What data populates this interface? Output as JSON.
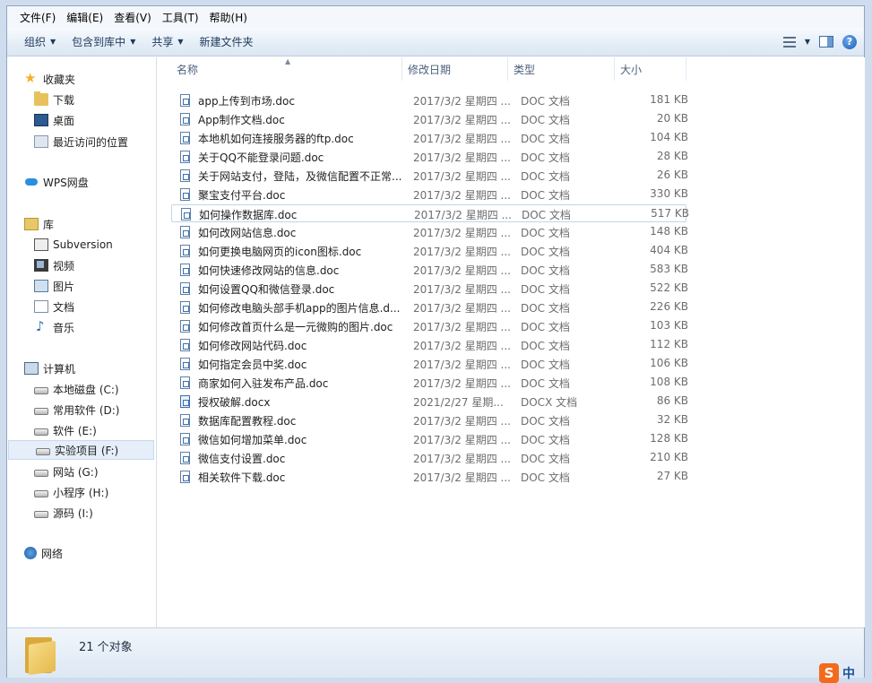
{
  "menu": [
    "文件(F)",
    "编辑(E)",
    "查看(V)",
    "工具(T)",
    "帮助(H)"
  ],
  "toolbar": {
    "organize": "组织",
    "include_in_library": "包含到库中",
    "share": "共享",
    "new_folder": "新建文件夹"
  },
  "nav": {
    "favorites": "收藏夹",
    "downloads": "下载",
    "desktop": "桌面",
    "recent": "最近访问的位置",
    "wps": "WPS网盘",
    "library": "库",
    "subversion": "Subversion",
    "videos": "视频",
    "pictures": "图片",
    "documents": "文档",
    "music": "音乐",
    "computer": "计算机",
    "drive_c": "本地磁盘 (C:)",
    "drive_d": "常用软件 (D:)",
    "drive_e": "软件 (E:)",
    "drive_f": "实验项目 (F:)",
    "drive_g": "网站 (G:)",
    "drive_h": "小程序 (H:)",
    "drive_i": "源码 (I:)",
    "network": "网络"
  },
  "columns": {
    "name": "名称",
    "date": "修改日期",
    "type": "类型",
    "size": "大小"
  },
  "files": [
    {
      "name": "app上传到市场.doc",
      "date": "2017/3/2 星期四 ...",
      "type": "DOC 文档",
      "size": "181 KB"
    },
    {
      "name": "App制作文档.doc",
      "date": "2017/3/2 星期四 ...",
      "type": "DOC 文档",
      "size": "20 KB"
    },
    {
      "name": "本地机如何连接服务器的ftp.doc",
      "date": "2017/3/2 星期四 ...",
      "type": "DOC 文档",
      "size": "104 KB"
    },
    {
      "name": "关于QQ不能登录问题.doc",
      "date": "2017/3/2 星期四 ...",
      "type": "DOC 文档",
      "size": "28 KB"
    },
    {
      "name": "关于网站支付，登陆，及微信配置不正常...",
      "date": "2017/3/2 星期四 ...",
      "type": "DOC 文档",
      "size": "26 KB"
    },
    {
      "name": "聚宝支付平台.doc",
      "date": "2017/3/2 星期四 ...",
      "type": "DOC 文档",
      "size": "330 KB"
    },
    {
      "name": "如何操作数据库.doc",
      "date": "2017/3/2 星期四 ...",
      "type": "DOC 文档",
      "size": "517 KB"
    },
    {
      "name": "如何改网站信息.doc",
      "date": "2017/3/2 星期四 ...",
      "type": "DOC 文档",
      "size": "148 KB"
    },
    {
      "name": "如何更换电脑网页的icon图标.doc",
      "date": "2017/3/2 星期四 ...",
      "type": "DOC 文档",
      "size": "404 KB"
    },
    {
      "name": "如何快速修改网站的信息.doc",
      "date": "2017/3/2 星期四 ...",
      "type": "DOC 文档",
      "size": "583 KB"
    },
    {
      "name": "如何设置QQ和微信登录.doc",
      "date": "2017/3/2 星期四 ...",
      "type": "DOC 文档",
      "size": "522 KB"
    },
    {
      "name": "如何修改电脑头部手机app的图片信息.d...",
      "date": "2017/3/2 星期四 ...",
      "type": "DOC 文档",
      "size": "226 KB"
    },
    {
      "name": "如何修改首页什么是一元微购的图片.doc",
      "date": "2017/3/2 星期四 ...",
      "type": "DOC 文档",
      "size": "103 KB"
    },
    {
      "name": "如何修改网站代码.doc",
      "date": "2017/3/2 星期四 ...",
      "type": "DOC 文档",
      "size": "112 KB"
    },
    {
      "name": "如何指定会员中奖.doc",
      "date": "2017/3/2 星期四 ...",
      "type": "DOC 文档",
      "size": "106 KB"
    },
    {
      "name": "商家如何入驻发布产品.doc",
      "date": "2017/3/2 星期四 ...",
      "type": "DOC 文档",
      "size": "108 KB"
    },
    {
      "name": "授权破解.docx",
      "date": "2021/2/27 星期...",
      "type": "DOCX 文档",
      "size": "86 KB"
    },
    {
      "name": "数据库配置教程.doc",
      "date": "2017/3/2 星期四 ...",
      "type": "DOC 文档",
      "size": "32 KB"
    },
    {
      "name": "微信如何增加菜单.doc",
      "date": "2017/3/2 星期四 ...",
      "type": "DOC 文档",
      "size": "128 KB"
    },
    {
      "name": "微信支付设置.doc",
      "date": "2017/3/2 星期四 ...",
      "type": "DOC 文档",
      "size": "210 KB"
    },
    {
      "name": "相关软件下载.doc",
      "date": "2017/3/2 星期四 ...",
      "type": "DOC 文档",
      "size": "27 KB"
    }
  ],
  "status": {
    "count": "21 个对象"
  },
  "ime": {
    "logo": "S",
    "mode": "中"
  }
}
